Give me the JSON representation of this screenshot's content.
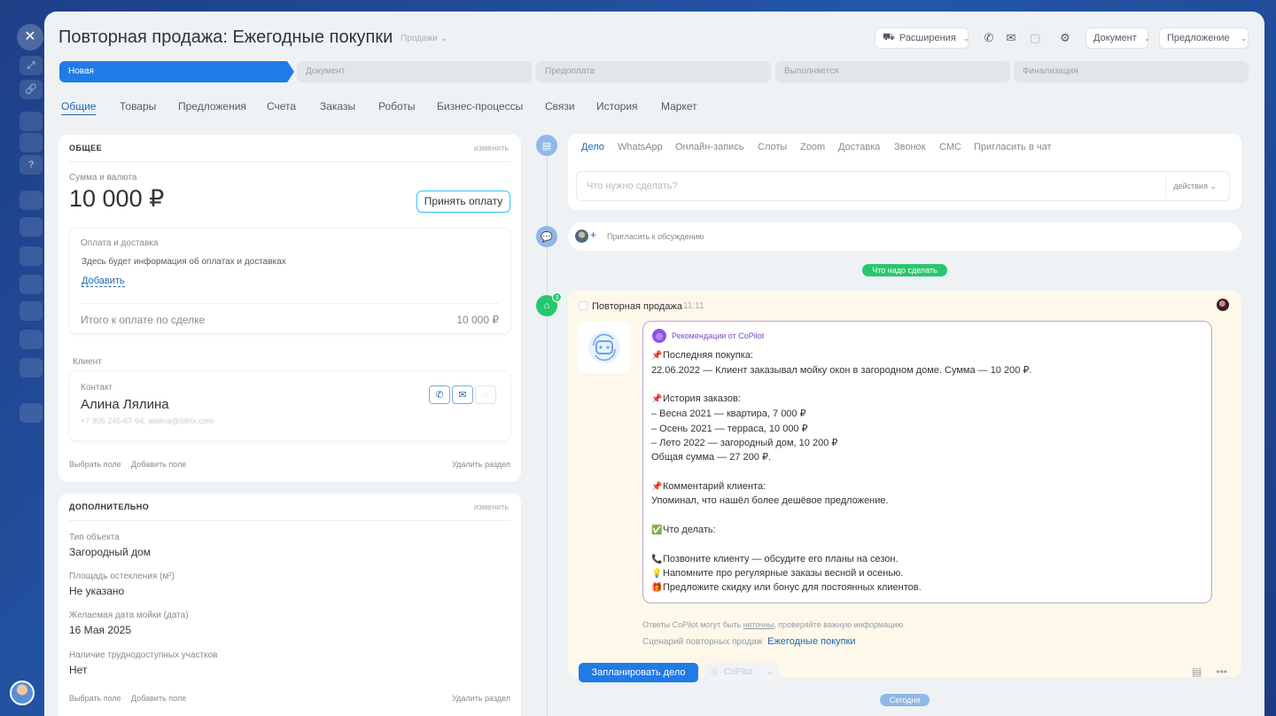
{
  "header": {
    "title": "Повторная продажа: Ежегодные покупки",
    "category": "Продажи",
    "extensions_label": "Расширения",
    "document_label": "Документ",
    "offer_label": "Предложение"
  },
  "stages": [
    "Новая",
    "Документ",
    "Предоплата",
    "Выполняется",
    "Финализация"
  ],
  "tabs": [
    "Общие",
    "Товары",
    "Предложения",
    "Счета",
    "Заказы",
    "Роботы",
    "Бизнес-процессы",
    "Связи",
    "История",
    "Маркет"
  ],
  "general": {
    "heading": "ОБЩЕЕ",
    "edit_link": "изменить",
    "amount_label": "Сумма и валюта",
    "amount_value": "10 000 ₽",
    "accept_button": "Принять оплату",
    "payment_title": "Оплата и доставка",
    "payment_info": "Здесь будет информация об оплатах и доставках",
    "add_link": "Добавить",
    "total_label": "Итого к оплате по сделке",
    "total_value": "10 000 ₽",
    "client_label": "Клиент",
    "contact_label": "Контакт",
    "contact_name": "Алина Лялина",
    "contact_details": "+7 905 245-67-94, alalina@bitrix.com",
    "select_field": "Выбрать поле",
    "add_field": "Добавить поле",
    "delete_section": "Удалить раздел"
  },
  "additional": {
    "heading": "ДОПОЛНИТЕЛЬНО",
    "edit_link": "изменить",
    "fields": [
      {
        "label": "Тип объекта",
        "value": "Загородный дом"
      },
      {
        "label": "Площадь остекления (м²)",
        "value": "Не указано"
      },
      {
        "label": "Желаемая дата мойки (дата)",
        "value": "16 Мая 2025"
      },
      {
        "label": "Наличие труднодоступных участков",
        "value": "Нет"
      }
    ],
    "select_field": "Выбрать поле",
    "add_field": "Добавить поле",
    "delete_section": "Удалить раздел"
  },
  "activity": {
    "tabs": [
      "Дело",
      "WhatsApp",
      "Онлайн-запись",
      "Слоты",
      "Zoom",
      "Доставка",
      "Звонок",
      "СМС",
      "Пригласить в чат"
    ],
    "placeholder": "Что нужно сделать?",
    "actions_label": "действия",
    "invite_label": "Пригласить к обсуждению"
  },
  "timeline": {
    "todo_pill": "Что надо сделать",
    "today_pill": "Сегодня",
    "badge_count": "3",
    "item_title": "Повторная продажа",
    "item_time": "11:11",
    "rec_title": "Рекомендации от CoPilot",
    "rec_lines": [
      {
        "emoji": "📌",
        "text": "Последняя покупка:"
      },
      {
        "emoji": "",
        "text": "22.06.2022 — Клиент заказывал мойку окон в загородном доме. Сумма — 10 200 ₽."
      },
      {
        "emoji": "📌",
        "text": "История заказов:"
      },
      {
        "emoji": "",
        "text": "– Весна 2021 — квартира, 7 000 ₽"
      },
      {
        "emoji": "",
        "text": "– Осень 2021 — терраса, 10 000 ₽"
      },
      {
        "emoji": "",
        "text": "– Лето 2022 — загородный дом, 10 200 ₽"
      },
      {
        "emoji": "",
        "text": "Общая сумма — 27 200 ₽."
      },
      {
        "emoji": "📌",
        "text": "Комментарий клиента:"
      },
      {
        "emoji": "",
        "text": "Упоминал, что нашёл более дешёвое предложение."
      },
      {
        "emoji": "✅",
        "text": "Что делать:"
      },
      {
        "emoji": "📞",
        "text": "Позвоните клиенту — обсудите его планы на сезон."
      },
      {
        "emoji": "💡",
        "text": "Напомните про регулярные заказы весной и осенью."
      },
      {
        "emoji": "🎁",
        "text": "Предложите скидку или бонус для постоянных клиентов."
      }
    ],
    "disclaimer_prefix": "Ответы CoPilot могут быть ",
    "disclaimer_link": "неточны",
    "disclaimer_suffix": ", проверяйте важную информацию",
    "scenario_prefix": "Сценарий повторных продаж",
    "scenario_link": "Ежегодные покупки",
    "plan_button": "Запланировать дело",
    "copilot_button": "CoPilot"
  },
  "colors": {
    "accent": "#1f7be7",
    "todo_pill": "#28c76f",
    "today_pill": "#8fb8e8",
    "copilot_purple": "#8e52ec"
  }
}
